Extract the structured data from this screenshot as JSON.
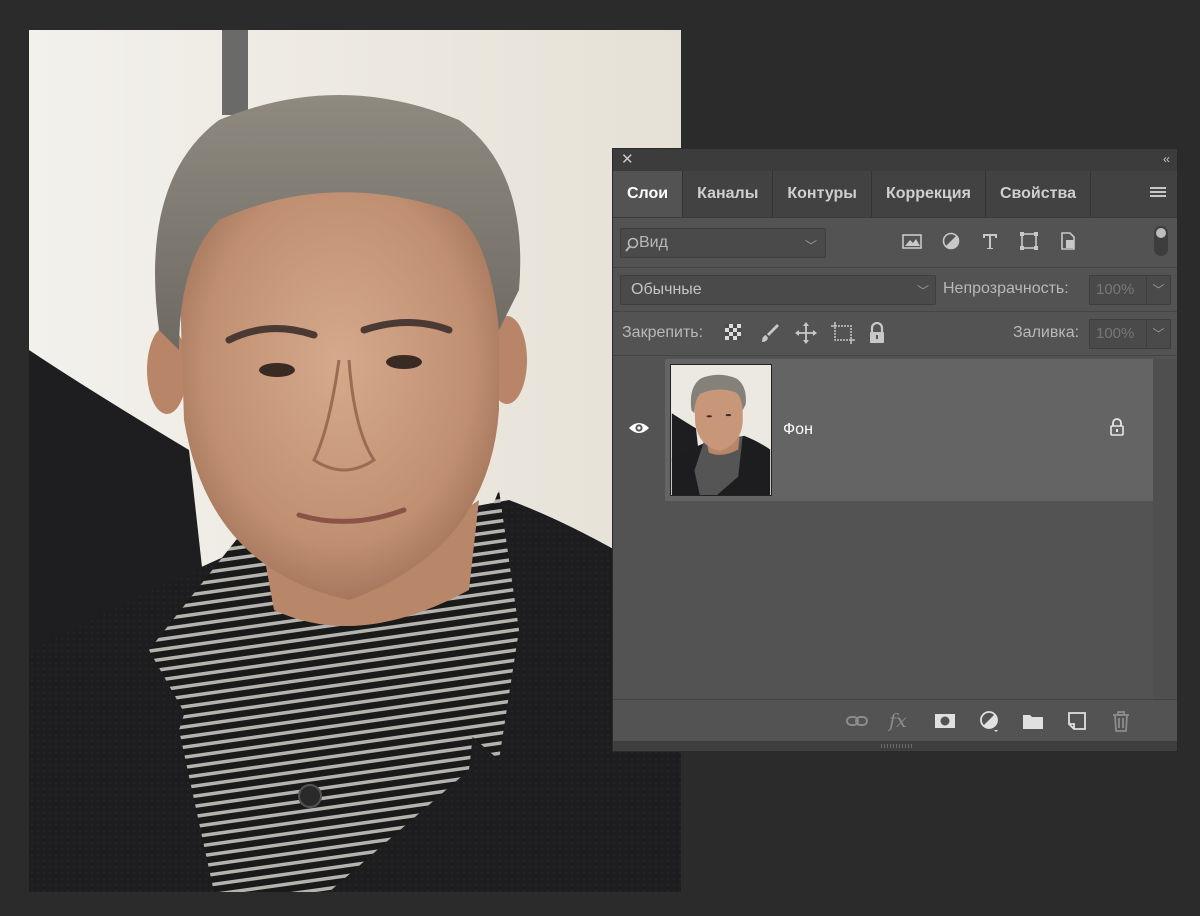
{
  "panel": {
    "close_glyph": "✕",
    "collapse_glyph": "‹‹",
    "tabs": [
      {
        "label": "Слои",
        "active": true
      },
      {
        "label": "Каналы",
        "active": false
      },
      {
        "label": "Контуры",
        "active": false
      },
      {
        "label": "Коррекция",
        "active": false
      },
      {
        "label": "Свойства",
        "active": false
      }
    ],
    "filter": {
      "placeholder": "Вид"
    },
    "blend_mode": "Обычные",
    "opacity_label": "Непрозрачность:",
    "opacity_value": "100%",
    "lock_label": "Закрепить:",
    "fill_label": "Заливка:",
    "fill_value": "100%",
    "layers": [
      {
        "name": "Фон",
        "visible": true,
        "locked": true
      }
    ],
    "footer_fx": "fx"
  },
  "icons": {
    "filter": [
      "image-filter-icon",
      "adjustment-filter-icon",
      "type-filter-icon",
      "shape-filter-icon",
      "smart-object-filter-icon"
    ],
    "locks": [
      "lock-transparent-pixels-icon",
      "lock-image-pixels-icon",
      "lock-position-icon",
      "lock-artboard-icon",
      "lock-all-icon"
    ],
    "footer": [
      "link-layers-icon",
      "fx-icon",
      "add-mask-icon",
      "new-adjustment-icon",
      "new-group-icon",
      "new-layer-icon",
      "delete-layer-icon"
    ]
  },
  "colors": {
    "workspace": "#2b2b2b",
    "panel": "#535353",
    "selected_layer": "#646464"
  }
}
